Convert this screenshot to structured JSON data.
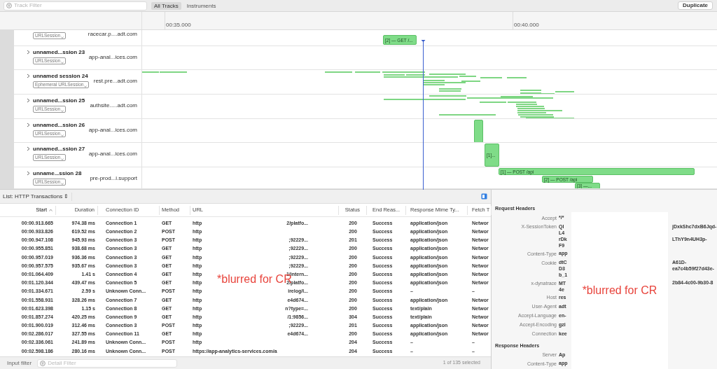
{
  "toolbar": {
    "filter_placeholder": "Track Filter",
    "scopes": [
      {
        "label": "All Tracks",
        "selected": true
      },
      {
        "label": "Instruments",
        "selected": false
      }
    ],
    "action": "Duplicate"
  },
  "ruler": {
    "ticks": [
      "00:35.000",
      "00:40.000"
    ]
  },
  "tracks": [
    {
      "badge": "URLSession",
      "host": "racecar.p....adt.com",
      "events": [
        {
          "label": "[2]  — GET /..."
        }
      ]
    },
    {
      "name": "unnamed...ssion 23",
      "badge": "URLSession",
      "host": "app-anal...ices.com"
    },
    {
      "name": "unnamed session 24",
      "badge": "Ephemeral URLSession",
      "host": "rest.pre...adt.com"
    },
    {
      "name": "unnamed...ssion 25",
      "badge": "URLSession",
      "host": "authsite.....adt.com"
    },
    {
      "name": "unnamed...ssion 26",
      "badge": "URLSession",
      "host": "app-anal...ices.com"
    },
    {
      "name": "unnamed...ssion 27",
      "badge": "URLSession",
      "host": "app-anal...ices.com",
      "events": [
        {
          "label": "[1]..."
        }
      ]
    },
    {
      "name": "unname...ssion 28",
      "badge": "URLSession",
      "host": "pre-prod...i.support",
      "events": [
        {
          "label": "[1]  — POST /api"
        },
        {
          "label": "[2]  — POST /api"
        },
        {
          "label": "[3]  —..."
        }
      ]
    }
  ],
  "list": {
    "title": "List: HTTP Transactions ⇕",
    "columns": [
      {
        "label": "Start",
        "sorted": true
      },
      {
        "label": "Duration",
        "sorted": false
      },
      {
        "label": "Connection ID",
        "sorted": false
      },
      {
        "label": "Method",
        "sorted": false
      },
      {
        "label": "URL",
        "sorted": false
      },
      {
        "label": "Status",
        "sorted": false
      },
      {
        "label": "End Reas...",
        "sorted": false
      },
      {
        "label": "Response Mime Ty...",
        "sorted": false
      },
      {
        "label": "Fetch T",
        "sorted": false
      }
    ],
    "rows": [
      {
        "start": "00:00.913.665",
        "duration": "974.38 ms",
        "connection": "Connection 1",
        "method": "GET",
        "url_start": "http",
        "url_end": "2/platfo...",
        "status": "200",
        "end_reason": "Success",
        "mime": "application/json",
        "fetch": "Networ"
      },
      {
        "start": "00:00.933.826",
        "duration": "619.52 ms",
        "connection": "Connection 2",
        "method": "POST",
        "url_start": "http",
        "url_end": "",
        "status": "200",
        "end_reason": "Success",
        "mime": "application/json",
        "fetch": "Networ"
      },
      {
        "start": "00:00.947.108",
        "duration": "945.93 ms",
        "connection": "Connection 3",
        "method": "POST",
        "url_start": "http",
        "url_end": ";92229...",
        "status": "201",
        "end_reason": "Success",
        "mime": "application/json",
        "fetch": "Networ"
      },
      {
        "start": "00:00.955.851",
        "duration": "938.68 ms",
        "connection": "Connection 3",
        "method": "GET",
        "url_start": "http",
        "url_end": ";92229...",
        "status": "200",
        "end_reason": "Success",
        "mime": "application/json",
        "fetch": "Networ"
      },
      {
        "start": "00:00.957.019",
        "duration": "936.36 ms",
        "connection": "Connection 3",
        "method": "GET",
        "url_start": "http",
        "url_end": ";92229...",
        "status": "200",
        "end_reason": "Success",
        "mime": "application/json",
        "fetch": "Networ"
      },
      {
        "start": "00:00.957.575",
        "duration": "935.67 ms",
        "connection": "Connection 3",
        "method": "GET",
        "url_start": "http",
        "url_end": ";92229...",
        "status": "200",
        "end_reason": "Success",
        "mime": "application/json",
        "fetch": "Networ"
      },
      {
        "start": "00:01.064.409",
        "duration": "1.41 s",
        "connection": "Connection 4",
        "method": "GET",
        "url_start": "http",
        "url_end": "1/intern...",
        "status": "200",
        "end_reason": "Success",
        "mime": "application/json",
        "fetch": "Networ"
      },
      {
        "start": "00:01.120.344",
        "duration": "439.47 ms",
        "connection": "Connection 5",
        "method": "GET",
        "url_start": "http",
        "url_end": "2/platfo...",
        "status": "200",
        "end_reason": "Success",
        "mime": "application/json",
        "fetch": "Networ"
      },
      {
        "start": "00:01.334.671",
        "duration": "2.59 s",
        "connection": "Unknown Conn...",
        "method": "POST",
        "url_start": "http",
        "url_end": "irelog/l...",
        "status": "200",
        "end_reason": "Success",
        "mime": "–",
        "fetch": "–"
      },
      {
        "start": "00:01.558.931",
        "duration": "328.26 ms",
        "connection": "Connection 7",
        "method": "GET",
        "url_start": "http",
        "url_end": "e4d674...",
        "status": "200",
        "end_reason": "Success",
        "mime": "application/json",
        "fetch": "Networ"
      },
      {
        "start": "00:01.623.398",
        "duration": "1.15 s",
        "connection": "Connection 8",
        "method": "GET",
        "url_start": "http",
        "url_end": "n?type=...",
        "status": "200",
        "end_reason": "Success",
        "mime": "text/plain",
        "fetch": "Networ"
      },
      {
        "start": "00:01.857.274",
        "duration": "420.25 ms",
        "connection": "Connection 9",
        "method": "GET",
        "url_start": "http",
        "url_end": "/1:9856...",
        "status": "304",
        "end_reason": "Success",
        "mime": "text/plain",
        "fetch": "Networ"
      },
      {
        "start": "00:01.900.019",
        "duration": "312.46 ms",
        "connection": "Connection 3",
        "method": "POST",
        "url_start": "http",
        "url_end": ";92229...",
        "status": "201",
        "end_reason": "Success",
        "mime": "application/json",
        "fetch": "Networ"
      },
      {
        "start": "00:02.286.017",
        "duration": "327.55 ms",
        "connection": "Connection 11",
        "method": "GET",
        "url_start": "http",
        "url_end": "e4d674...",
        "status": "200",
        "end_reason": "Success",
        "mime": "application/json",
        "fetch": "Networ"
      },
      {
        "start": "00:02.336.061",
        "duration": "241.89 ms",
        "connection": "Unknown Conn...",
        "method": "POST",
        "url_start": "http",
        "url_end": "",
        "status": "204",
        "end_reason": "Success",
        "mime": "–",
        "fetch": "–"
      },
      {
        "start": "00:02.598.186",
        "duration": "280.16 ms",
        "connection": "Unknown Conn...",
        "method": "POST",
        "url_start": "https://app-analytics-services.com/a",
        "url_end": "",
        "status": "204",
        "end_reason": "Success",
        "mime": "–",
        "fetch": "–"
      }
    ],
    "input_filter_label": "Input filter",
    "detail_filter_placeholder": "Detail Filter",
    "selection_count": "1 of 135 selected"
  },
  "details": [
    {
      "title": "Request Headers",
      "rows": [
        {
          "key": "Accept",
          "lines": [
            {
              "left": "*/*"
            }
          ]
        },
        {
          "key": "X-SessionToken",
          "lines": [
            {
              "left": "Ql",
              "right": "jDxkShc7dxB6Jqd-"
            },
            {
              "left": "L4"
            },
            {
              "left": "rDk",
              "right": "LThY9n4UH3p-"
            },
            {
              "left": "F9"
            }
          ]
        },
        {
          "key": "Content-Type",
          "lines": [
            {
              "left": "app"
            }
          ]
        },
        {
          "key": "Cookie",
          "lines": [
            {
              "left": "dtC",
              "right": "A61D-"
            },
            {
              "left": "D3",
              "right": "ea7c4b59f27d43e-"
            },
            {
              "left": "b_1"
            }
          ]
        },
        {
          "key": "x-dynatrace",
          "lines": [
            {
              "left": "MT",
              "right": "2b84-4c00-9b30-8"
            },
            {
              "left": "4e"
            }
          ]
        },
        {
          "key": "Host",
          "lines": [
            {
              "left": "res"
            }
          ]
        },
        {
          "key": "User-Agent",
          "lines": [
            {
              "left": "adt"
            }
          ]
        },
        {
          "key": "Accept-Language",
          "lines": [
            {
              "left": "en-"
            }
          ]
        },
        {
          "key": "Accept-Encoding",
          "lines": [
            {
              "left": "gzi"
            }
          ]
        },
        {
          "key": "Connection",
          "lines": [
            {
              "left": "kee"
            }
          ]
        }
      ]
    },
    {
      "title": "Response Headers",
      "rows": [
        {
          "key": "Server",
          "lines": [
            {
              "left": "Ap"
            }
          ]
        },
        {
          "key": "Content-Type",
          "lines": [
            {
              "left": "app"
            }
          ]
        }
      ]
    }
  ],
  "redaction_notes": [
    "*blurred for CR",
    "*blurred for CR"
  ]
}
